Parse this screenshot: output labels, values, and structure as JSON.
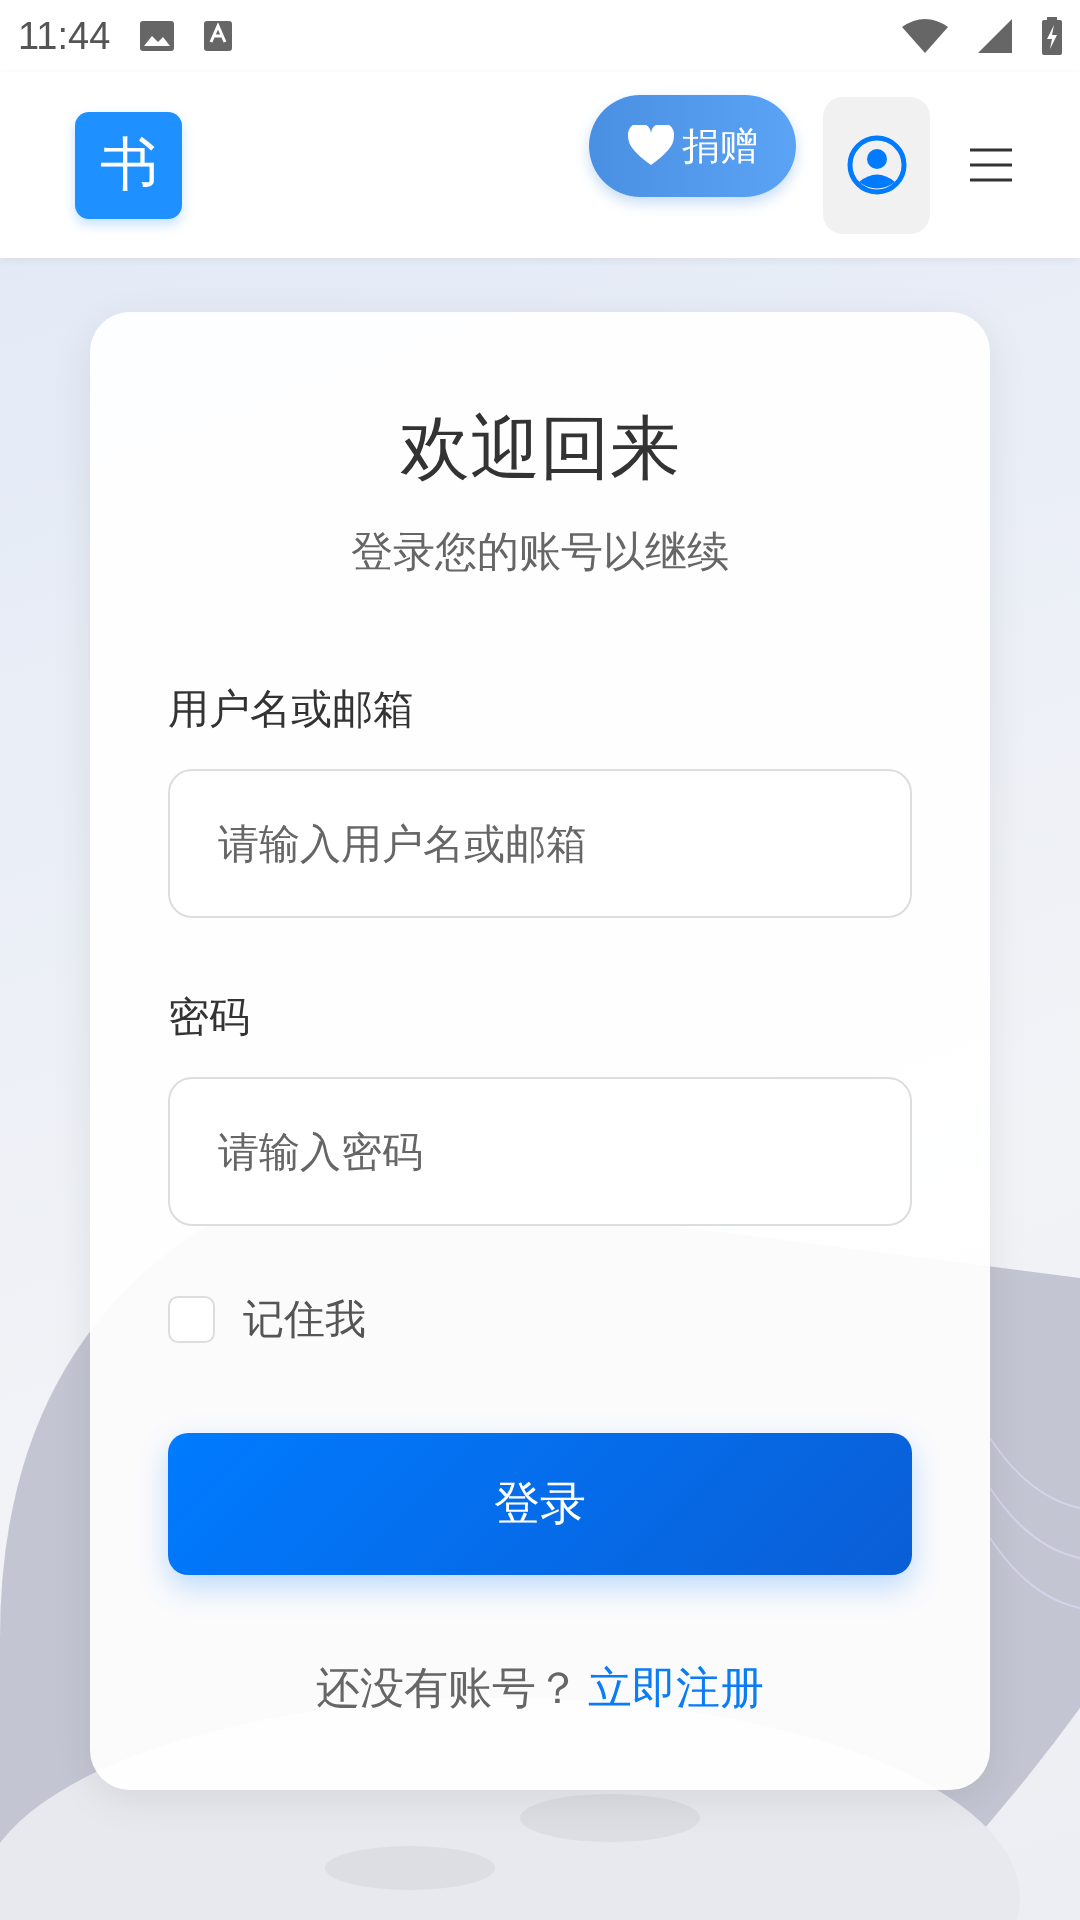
{
  "status_bar": {
    "time": "11:44"
  },
  "header": {
    "logo": "书",
    "donate_button": "捐赠"
  },
  "card": {
    "title": "欢迎回来",
    "subtitle": "登录您的账号以继续",
    "fields": [
      {
        "label": "用户名或邮箱",
        "placeholder": "请输入用户名或邮箱"
      },
      {
        "label": "密码",
        "placeholder": "请输入密码"
      }
    ],
    "remember": {
      "label": "记住我",
      "checked": false
    },
    "login_button": "登录",
    "footer": {
      "prompt": "还没有账号？",
      "link": "立即注册"
    }
  }
}
